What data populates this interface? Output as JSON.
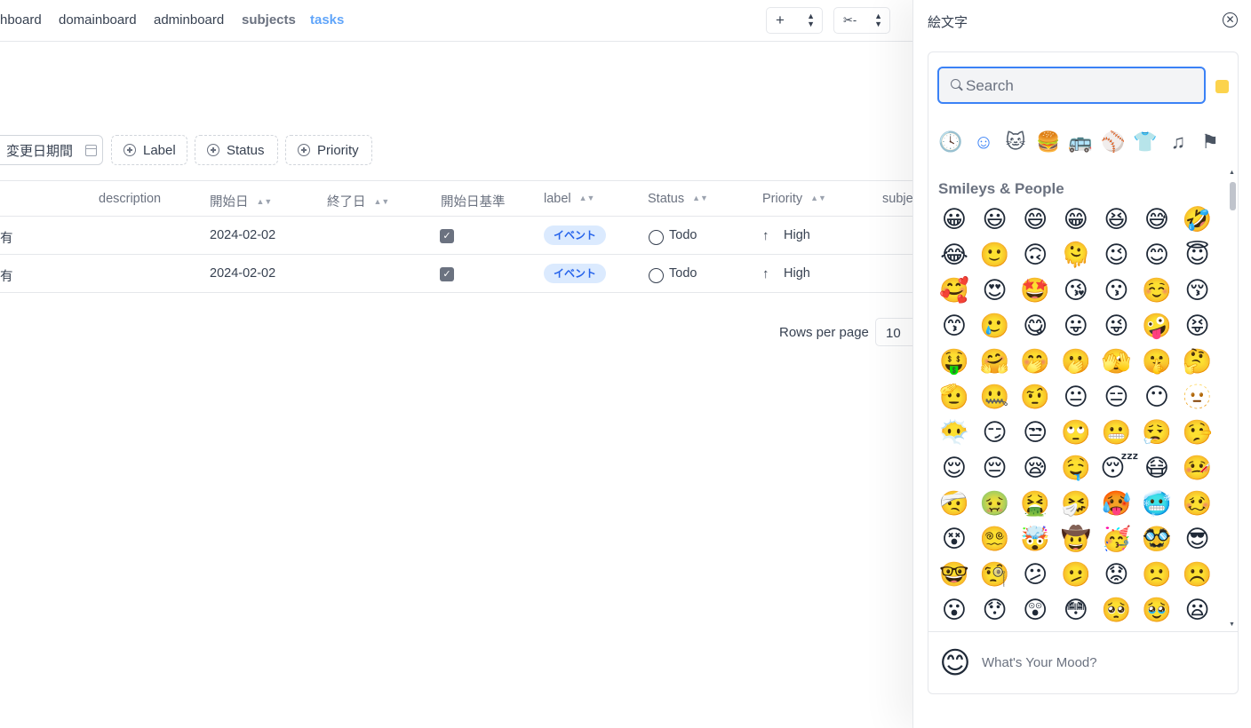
{
  "nav": {
    "links": [
      "hboard",
      "domainboard",
      "adminboard",
      "subjects",
      "tasks"
    ],
    "add_select_icon": "+",
    "tool_select_icon": "✂-"
  },
  "filters": {
    "date_range": "変更日期間",
    "label": "Label",
    "status": "Status",
    "priority": "Priority"
  },
  "table": {
    "headers": {
      "description": "description",
      "start_date": "開始日",
      "end_date": "終了日",
      "start_basis": "開始日基準",
      "label": "label",
      "status": "Status",
      "priority": "Priority",
      "subject": "subje"
    },
    "rows": [
      {
        "title": "有",
        "start_date": "2024-02-02",
        "end_date": "",
        "label": "イベント",
        "status": "Todo",
        "priority": "High"
      },
      {
        "title": "有",
        "start_date": "2024-02-02",
        "end_date": "",
        "label": "イベント",
        "status": "Todo",
        "priority": "High"
      }
    ],
    "rows_per_page_label": "Rows per page",
    "rows_per_page_value": "10"
  },
  "drawer": {
    "title": "絵文字",
    "search_placeholder": "Search",
    "skin_tone_color": "#fcd34d",
    "categories": [
      "🕓",
      "☺",
      "🐱",
      "🍔",
      "🚌",
      "⚾",
      "👕",
      "♫",
      "⚑"
    ],
    "section_title": "Smileys & People",
    "emojis": [
      "😀",
      "😃",
      "😄",
      "😁",
      "😆",
      "😅",
      "🤣",
      "😂",
      "🙂",
      "🙃",
      "🫠",
      "😉",
      "😊",
      "😇",
      "🥰",
      "😍",
      "🤩",
      "😘",
      "😗",
      "☺️",
      "😚",
      "😙",
      "🥲",
      "😋",
      "😛",
      "😜",
      "🤪",
      "😝",
      "🤑",
      "🤗",
      "🤭",
      "🫢",
      "🫣",
      "🤫",
      "🤔",
      "🫡",
      "🤐",
      "🤨",
      "😐",
      "😑",
      "😶",
      "🫥",
      "😶‍🌫️",
      "😏",
      "😒",
      "🙄",
      "😬",
      "😮‍💨",
      "🤥",
      "😌",
      "😔",
      "😪",
      "🤤",
      "😴",
      "😷",
      "🤒",
      "🤕",
      "🤢",
      "🤮",
      "🤧",
      "🥵",
      "🥶",
      "🥴",
      "😵",
      "😵‍💫",
      "🤯",
      "🤠",
      "🥳",
      "🥸",
      "😎",
      "🤓",
      "🧐",
      "😕",
      "🫤",
      "😟",
      "🙁",
      "☹️",
      "😮",
      "😯",
      "😲",
      "😳",
      "🥺",
      "🥹",
      "😦"
    ],
    "mood_emoji": "😊",
    "mood_placeholder": "What's Your Mood?"
  }
}
